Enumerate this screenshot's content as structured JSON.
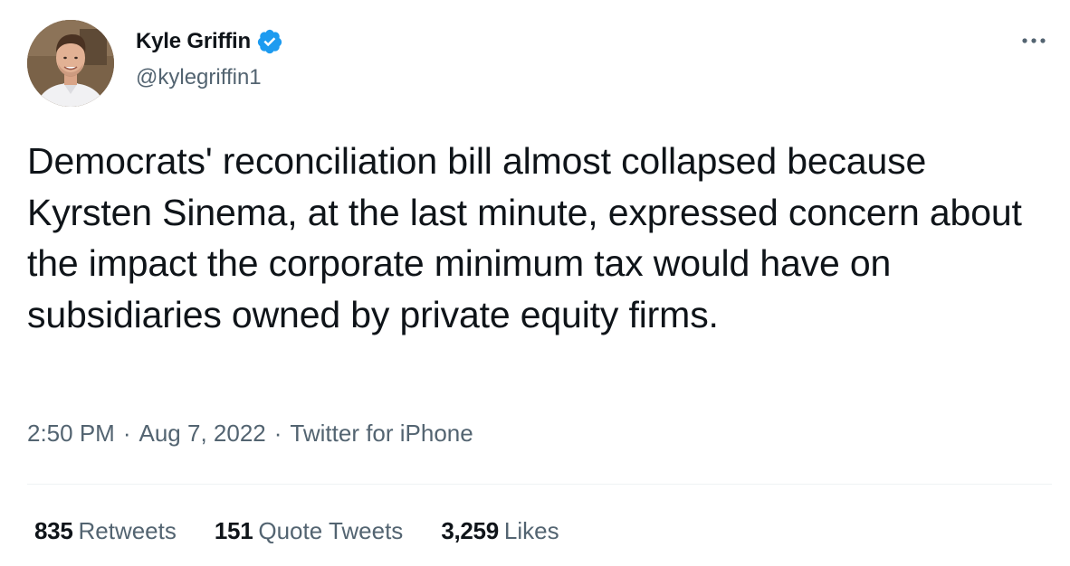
{
  "author": {
    "display_name": "Kyle Griffin",
    "handle": "@kylegriffin1",
    "verified": true
  },
  "tweet": {
    "text": "Democrats' reconciliation bill almost collapsed because Kyrsten Sinema, at the last minute, expressed concern about the impact the corporate minimum tax would have on subsidiaries owned by private equity firms."
  },
  "meta": {
    "time": "2:50 PM",
    "separator": "·",
    "date": "Aug 7, 2022",
    "source": "Twitter for iPhone"
  },
  "stats": {
    "retweets_count": "835",
    "retweets_label": "Retweets",
    "quotes_count": "151",
    "quotes_label": "Quote Tweets",
    "likes_count": "3,259",
    "likes_label": "Likes"
  },
  "icons": {
    "verified": "verified-badge-icon",
    "more": "more-options-icon"
  },
  "colors": {
    "text": "#0f1419",
    "secondary": "#536471",
    "verified_blue": "#1d9bf0",
    "divider": "#eff3f4"
  }
}
